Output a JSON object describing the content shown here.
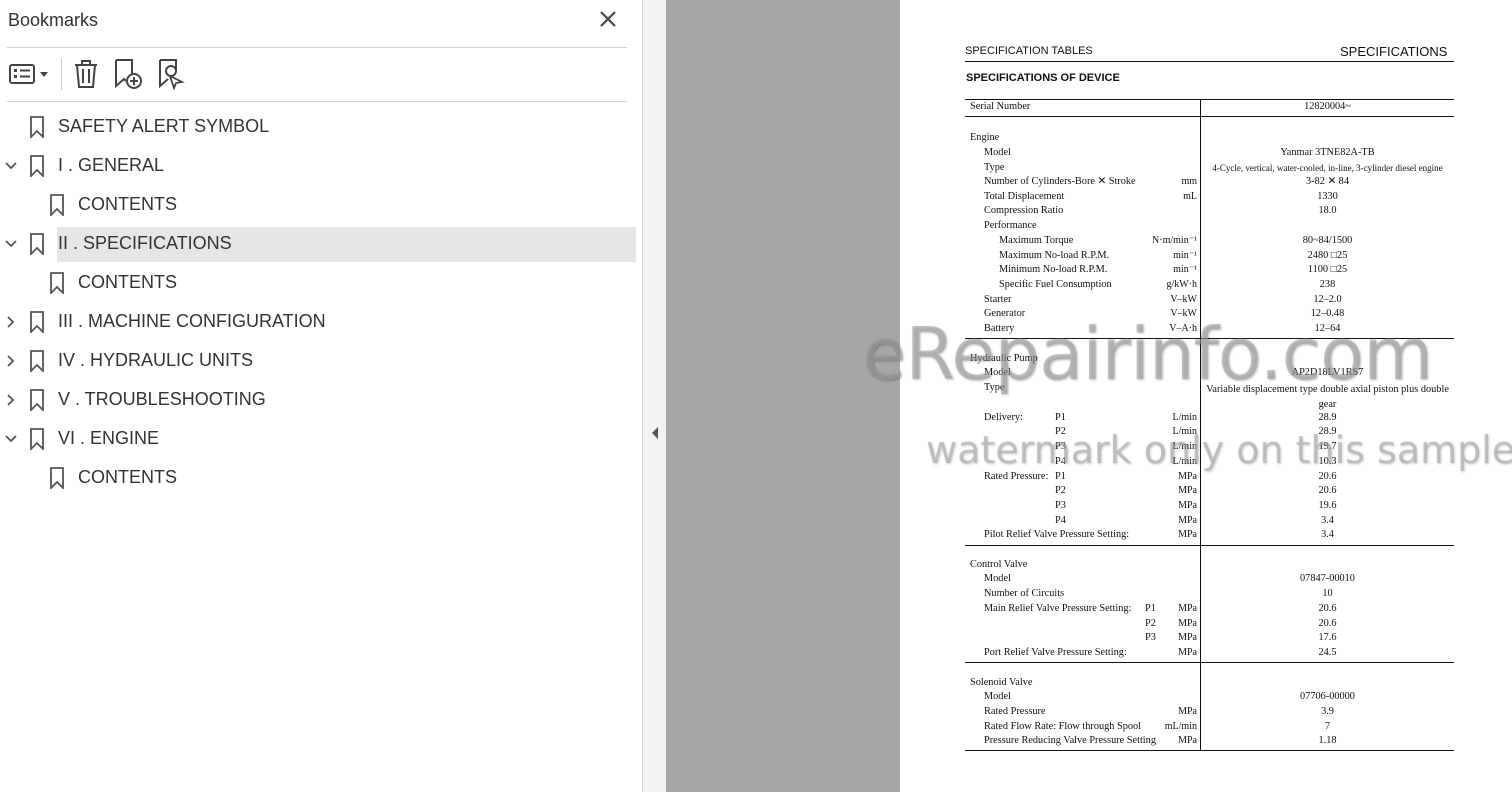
{
  "bookmarks_panel": {
    "title": "Bookmarks",
    "close_icon": "close-icon",
    "toolbar": [
      "options-menu-icon",
      "delete-bookmark-icon",
      "add-bookmark-icon",
      "find-current-bookmark-icon"
    ],
    "items": [
      {
        "label": "SAFETY ALERT SYMBOL",
        "level": 0,
        "expander": "none"
      },
      {
        "label": "I . GENERAL",
        "level": 0,
        "expander": "expanded"
      },
      {
        "label": "CONTENTS",
        "level": 1,
        "expander": "none"
      },
      {
        "label": "II . SPECIFICATIONS",
        "level": 0,
        "expander": "expanded",
        "selected": true
      },
      {
        "label": "CONTENTS",
        "level": 1,
        "expander": "none"
      },
      {
        "label": "III . MACHINE CONFIGURATION",
        "level": 0,
        "expander": "collapsed"
      },
      {
        "label": "IV . HYDRAULIC UNITS",
        "level": 0,
        "expander": "collapsed"
      },
      {
        "label": "V . TROUBLESHOOTING",
        "level": 0,
        "expander": "collapsed"
      },
      {
        "label": "VI . ENGINE",
        "level": 0,
        "expander": "expanded"
      },
      {
        "label": "CONTENTS",
        "level": 1,
        "expander": "none"
      }
    ]
  },
  "document": {
    "header_left": "SPECIFICATION TABLES",
    "header_right": "SPECIFICATIONS",
    "section_title": "SPECIFICATIONS OF DEVICE",
    "rows": [
      [
        "Serial Number",
        "",
        "",
        "12820004~"
      ],
      [
        "Engine",
        "",
        "",
        ""
      ],
      [
        "Model",
        "",
        "",
        "Yanmar 3TNE82A-TB"
      ],
      [
        "Type",
        "",
        "",
        "4-Cycle, vertical, water-cooled, in-line, 3-cylinder diesel engine"
      ],
      [
        "Number of Cylinders-Bore ✕ Stroke",
        "",
        "mm",
        "3-82 ✕ 84"
      ],
      [
        "Total Displacement",
        "",
        "mL",
        "1330"
      ],
      [
        "Compression Ratio",
        "",
        "",
        "18.0"
      ],
      [
        "Performance",
        "",
        "",
        ""
      ],
      [
        "Maximum Torque",
        "",
        "N·m/min⁻¹",
        "80~84/1500"
      ],
      [
        "Maximum No-load R.P.M.",
        "",
        "min⁻¹",
        "2480 □25"
      ],
      [
        "Minimum No-load R.P.M.",
        "",
        "min⁻¹",
        "1100 □25"
      ],
      [
        "Specific Fuel Consumption",
        "",
        "g/kW·h",
        "238"
      ],
      [
        "Starter",
        "",
        "V–kW",
        "12–2.0"
      ],
      [
        "Generator",
        "",
        "V–kW",
        "12–0.48"
      ],
      [
        "Battery",
        "",
        "V–A·h",
        "12–64"
      ],
      [
        "Hydraulic Pump",
        "",
        "",
        ""
      ],
      [
        "Model",
        "",
        "",
        "AP2D18LV1RS7"
      ],
      [
        "Type",
        "",
        "",
        "Variable displacement type double axial piston plus double gear"
      ],
      [
        "Delivery:",
        "P1",
        "L/min",
        "28.9"
      ],
      [
        "",
        "P2",
        "L/min",
        "28.9"
      ],
      [
        "",
        "P3",
        "L/min",
        "19.7"
      ],
      [
        "",
        "P4",
        "L/min",
        "10.3"
      ],
      [
        "Rated Pressure:",
        "P1",
        "MPa",
        "20.6"
      ],
      [
        "",
        "P2",
        "MPa",
        "20.6"
      ],
      [
        "",
        "P3",
        "MPa",
        "19.6"
      ],
      [
        "",
        "P4",
        "MPa",
        "3.4"
      ],
      [
        "Pilot Relief Valve Pressure Setting:",
        "",
        "MPa",
        "3.4"
      ],
      [
        "Control Valve",
        "",
        "",
        ""
      ],
      [
        "Model",
        "",
        "",
        "07847-00010"
      ],
      [
        "Number of Circuits",
        "",
        "",
        "10"
      ],
      [
        "Main Relief Valve Pressure Setting:",
        "P1",
        "MPa",
        "20.6"
      ],
      [
        "",
        "P2",
        "MPa",
        "20.6"
      ],
      [
        "",
        "P3",
        "MPa",
        "17.6"
      ],
      [
        "Port Relief Valve Pressure Setting:",
        "",
        "MPa",
        "24.5"
      ],
      [
        "Solenoid Valve",
        "",
        "",
        ""
      ],
      [
        "Model",
        "",
        "",
        "07706-00000"
      ],
      [
        "Rated Pressure",
        "",
        "MPa",
        "3.9"
      ],
      [
        "Rated Flow Rate: Flow through Spool",
        "",
        "mL/min",
        "7"
      ],
      [
        "Pressure Reducing Valve Pressure Setting",
        "",
        "MPa",
        "1.18"
      ]
    ]
  },
  "watermark": {
    "line1": "eRepairinfo.com",
    "line2": "watermark only on this sample"
  }
}
